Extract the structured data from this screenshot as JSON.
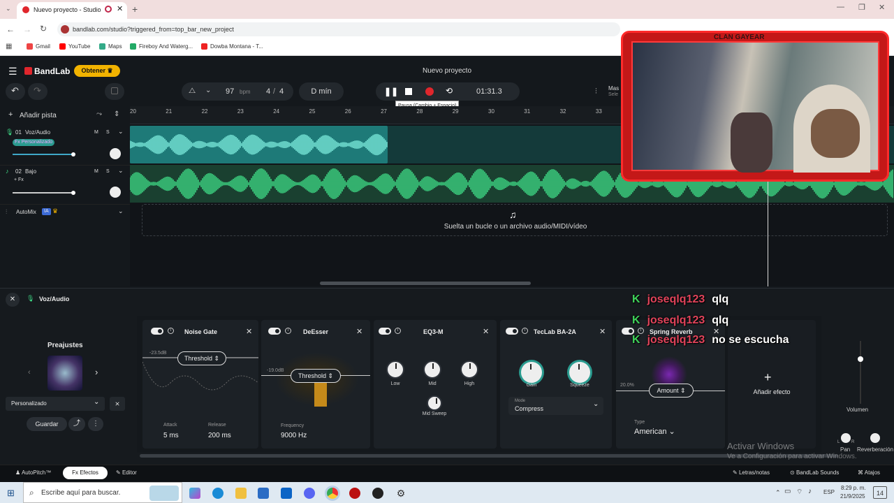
{
  "browser": {
    "tab_title": "Nuevo proyecto - Studio",
    "url": "bandlab.com/studio?triggered_from=top_bar_new_project",
    "bookmarks": [
      "Gmail",
      "YouTube",
      "Maps",
      "Fireboy And Waterg...",
      "Dowba Montana - T..."
    ]
  },
  "app": {
    "brand": "BandLab",
    "get_button": "Obtener",
    "project_title": "Nuevo proyecto",
    "bpm_value": "97",
    "bpm_unit": "bpm",
    "time_sig_top": "4",
    "time_sig_sep": "/",
    "time_sig_bottom": "4",
    "key": "D mín",
    "time": "01:31.3",
    "pause_tooltip": "Pausa (Cambio + Espacio)",
    "add_track": "Añadir pista",
    "master_label": "Mas",
    "master_sub": "Sele",
    "ruler": [
      "20",
      "21",
      "22",
      "23",
      "24",
      "25",
      "26",
      "27",
      "28",
      "29",
      "30",
      "31",
      "32",
      "33"
    ],
    "drop_text": "Suelta un bucle o un archivo audio/MIDI/vídeo",
    "colors": {
      "accent": "#3fe089",
      "orange": "#f2b300",
      "record": "#e0262c",
      "teal": "#2a9b8f"
    }
  },
  "tracks": [
    {
      "number": "01",
      "name": "Voz/Audio",
      "fx": "Fx Personalizado",
      "m": "M",
      "s": "S"
    },
    {
      "number": "02",
      "name": "Bajo",
      "fx": "+ Fx",
      "m": "M",
      "s": "S"
    }
  ],
  "automix": {
    "label": "AutoMix",
    "badge": "IA"
  },
  "fx_panel": {
    "track_name": "Voz/Audio",
    "presets_title": "Preajustes",
    "preset_selected": "Personalizado",
    "save": "Guardar",
    "add_effect": "Añadir efecto",
    "volume": "Volumen",
    "pan": "Pan",
    "reverb": "Reverberación",
    "pan_l": "L",
    "pan_r": "R",
    "cards": {
      "noise_gate": {
        "title": "Noise Gate",
        "db": "-23.5dB",
        "param": "Threshold",
        "attack_label": "Attack",
        "attack": "5 ms",
        "release_label": "Release",
        "release": "200 ms"
      },
      "deesser": {
        "title": "DeEsser",
        "db": "-19.0dB",
        "param": "Threshold",
        "freq_label": "Frequency",
        "freq": "9000 Hz"
      },
      "eq3": {
        "title": "EQ3-M",
        "low": "Low",
        "mid": "Mid",
        "high": "High",
        "sweep": "Mid Sweep"
      },
      "teclab": {
        "title": "TecLab BA-2A",
        "gain": "Gain",
        "squeeze": "Squeeze",
        "mode_label": "Mode",
        "mode": "Compress"
      },
      "spring": {
        "title": "Spring Reverb",
        "pct": "20.0%",
        "param": "Amount",
        "type_label": "Type",
        "type": "American"
      }
    }
  },
  "bottom_bar": {
    "autopitch": "AutoPitch™",
    "effects": "Efectos",
    "editor": "Editor",
    "lyrics": "Letras/notas",
    "sounds": "BandLab Sounds",
    "shortcuts": "Atajos"
  },
  "watermark": {
    "line1": "Activar Windows",
    "line2": "Ve a Configuración para activar Windows."
  },
  "chat": [
    {
      "user": "joseqlq123",
      "message": "qlq"
    },
    {
      "user": "joseqlq123",
      "message": "qlq"
    },
    {
      "user": "joseqlq123",
      "message": "no se escucha"
    }
  ],
  "webcam": {
    "banner": "CLAN GAYEAR"
  },
  "taskbar": {
    "search": "Escribe aquí para buscar.",
    "lang": "ESP",
    "clock_time": "8:29 p. m.",
    "clock_date": "21/9/2025",
    "notifications": "14"
  }
}
